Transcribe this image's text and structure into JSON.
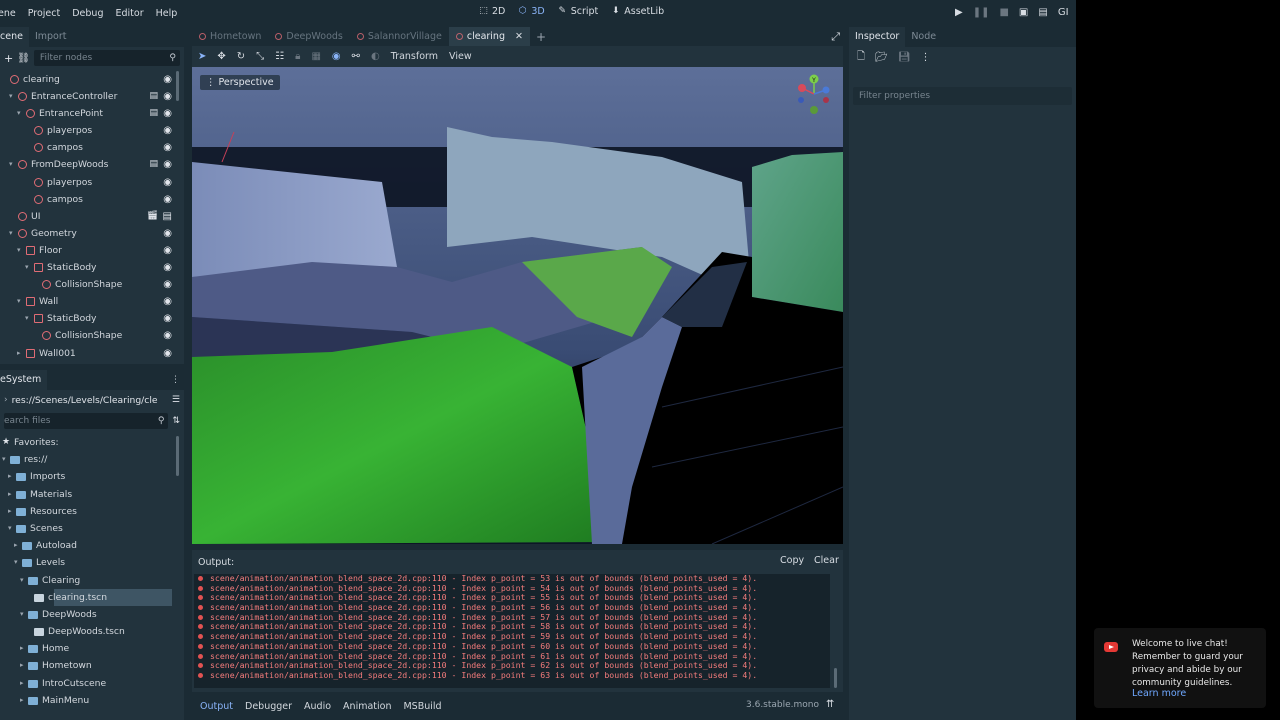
{
  "menubar": {
    "items": [
      "ene",
      "Project",
      "Debug",
      "Editor",
      "Help"
    ],
    "workspaces": [
      {
        "label": "2D",
        "icon": "2d-icon",
        "active": false
      },
      {
        "label": "3D",
        "icon": "3d-icon",
        "active": true
      },
      {
        "label": "Script",
        "icon": "script-icon",
        "active": false
      },
      {
        "label": "AssetLib",
        "icon": "assetlib-icon",
        "active": false
      }
    ],
    "gl_label": "GI"
  },
  "scene_dock": {
    "tabs": [
      "cene",
      "Import"
    ],
    "filter_placeholder": "Filter nodes",
    "nodes": [
      {
        "label": "clearing"
      },
      {
        "label": "EntranceController"
      },
      {
        "label": "EntrancePoint"
      },
      {
        "label": "playerpos"
      },
      {
        "label": "campos"
      },
      {
        "label": "FromDeepWoods"
      },
      {
        "label": "playerpos"
      },
      {
        "label": "campos"
      },
      {
        "label": "UI"
      },
      {
        "label": "Geometry"
      },
      {
        "label": "Floor"
      },
      {
        "label": "StaticBody"
      },
      {
        "label": "CollisionShape"
      },
      {
        "label": "Wall"
      },
      {
        "label": "StaticBody"
      },
      {
        "label": "CollisionShape"
      },
      {
        "label": "Wall001"
      }
    ]
  },
  "filesystem_dock": {
    "title": "eSystem",
    "path": "res://Scenes/Levels/Clearing/cle",
    "search_placeholder": "earch files",
    "items": [
      {
        "label": "Favorites:"
      },
      {
        "label": "res://"
      },
      {
        "label": "Imports"
      },
      {
        "label": "Materials"
      },
      {
        "label": "Resources"
      },
      {
        "label": "Scenes"
      },
      {
        "label": "Autoload"
      },
      {
        "label": "Levels"
      },
      {
        "label": "Clearing"
      },
      {
        "label": "clearing.tscn"
      },
      {
        "label": "DeepWoods"
      },
      {
        "label": "DeepWoods.tscn"
      },
      {
        "label": "Home"
      },
      {
        "label": "Hometown"
      },
      {
        "label": "IntroCutscene"
      },
      {
        "label": "MainMenu"
      }
    ]
  },
  "editor_tabs": [
    "Hometown",
    "DeepWoods",
    "SalannorVillage",
    "clearing"
  ],
  "toolbar": {
    "transform": "Transform",
    "view": "View"
  },
  "viewport": {
    "perspective_label": "Perspective"
  },
  "inspector": {
    "tabs": [
      "Inspector",
      "Node"
    ],
    "filter_placeholder": "Filter properties"
  },
  "output": {
    "title": "Output:",
    "copy": "Copy",
    "clear": "Clear",
    "lines": [
      "scene/animation/animation_blend_space_2d.cpp:110 - Index p_point = 53 is out of bounds (blend_points_used = 4).",
      "scene/animation/animation_blend_space_2d.cpp:110 - Index p_point = 54 is out of bounds (blend_points_used = 4).",
      "scene/animation/animation_blend_space_2d.cpp:110 - Index p_point = 55 is out of bounds (blend_points_used = 4).",
      "scene/animation/animation_blend_space_2d.cpp:110 - Index p_point = 56 is out of bounds (blend_points_used = 4).",
      "scene/animation/animation_blend_space_2d.cpp:110 - Index p_point = 57 is out of bounds (blend_points_used = 4).",
      "scene/animation/animation_blend_space_2d.cpp:110 - Index p_point = 58 is out of bounds (blend_points_used = 4).",
      "scene/animation/animation_blend_space_2d.cpp:110 - Index p_point = 59 is out of bounds (blend_points_used = 4).",
      "scene/animation/animation_blend_space_2d.cpp:110 - Index p_point = 60 is out of bounds (blend_points_used = 4).",
      "scene/animation/animation_blend_space_2d.cpp:110 - Index p_point = 61 is out of bounds (blend_points_used = 4).",
      "scene/animation/animation_blend_space_2d.cpp:110 - Index p_point = 62 is out of bounds (blend_points_used = 4).",
      "scene/animation/animation_blend_space_2d.cpp:110 - Index p_point = 63 is out of bounds (blend_points_used = 4)."
    ]
  },
  "bottom_tabs": [
    "Output",
    "Debugger",
    "Audio",
    "Animation",
    "MSBuild"
  ],
  "version": "3.6.stable.mono",
  "toast": {
    "message": "Welcome to live chat! Remember to guard your privacy and abide by our community guidelines.",
    "link": "Learn more"
  },
  "colors": {
    "editor_bg": "#1b2b34",
    "panel_bg": "#22333d",
    "accent": "#8ab4f8",
    "error_text": "#f47c7c",
    "node_icon": "#e06c75"
  }
}
